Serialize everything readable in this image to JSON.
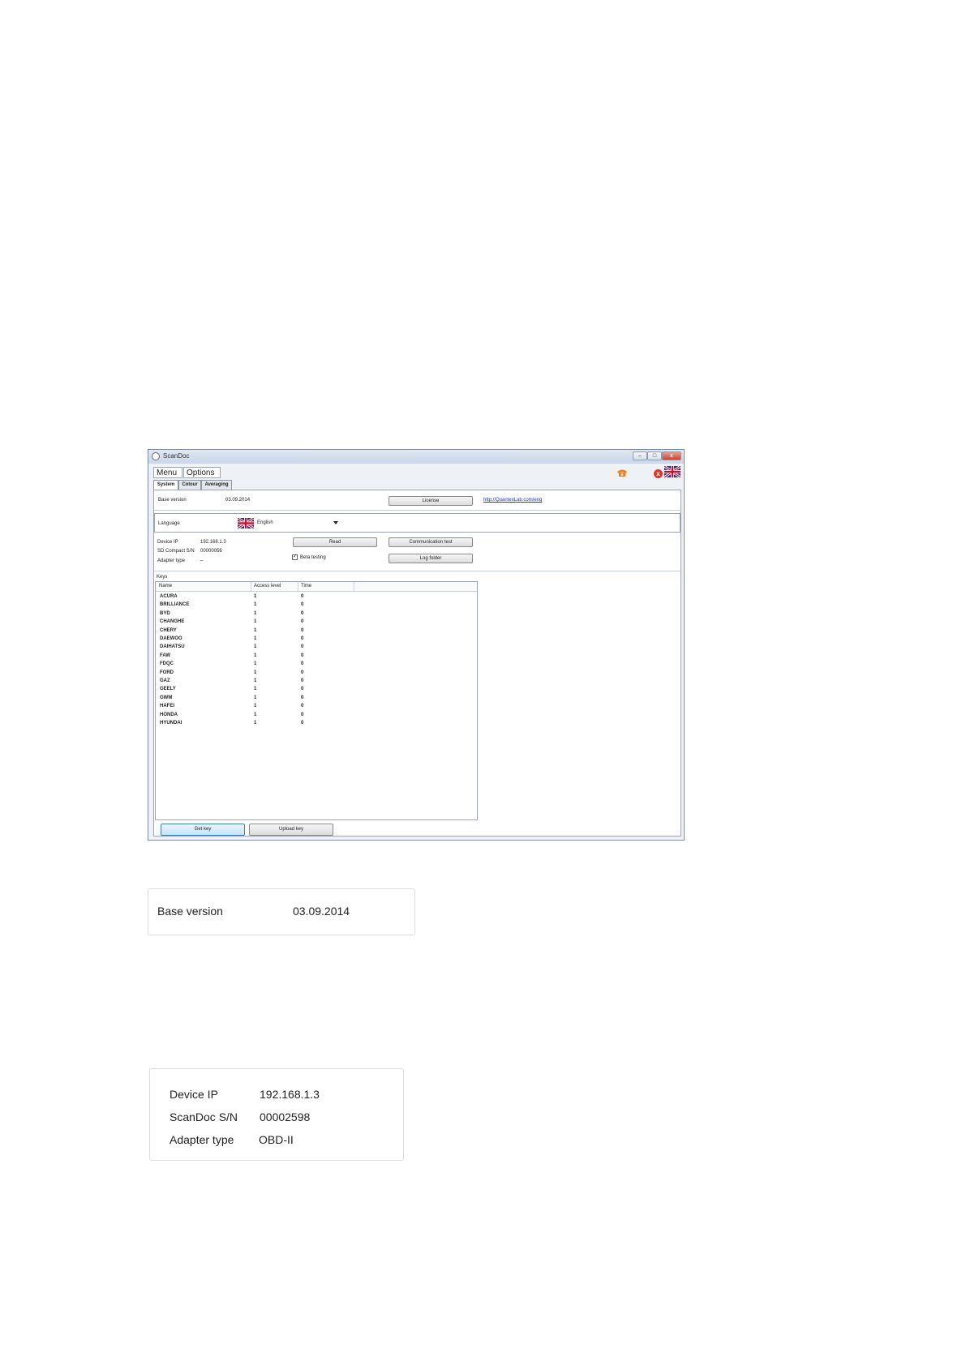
{
  "window": {
    "title": "ScanDoc",
    "controls": {
      "minimize": "–",
      "maximize": "□",
      "close": "x"
    }
  },
  "menu": {
    "items": [
      "Menu",
      "Options"
    ]
  },
  "tabs": [
    "System",
    "Colour",
    "Averaging"
  ],
  "system": {
    "base_version_label": "Base version",
    "base_version_value": "03.09.2014",
    "license_button": "License",
    "link": "http://QuantexLab.com/eng",
    "language_label": "Language",
    "language_value": "English",
    "device_ip_label": "Device IP",
    "device_ip_value": "192.168.1.3",
    "sn_label": "SD Compact S/N",
    "sn_value": "00000056",
    "adapter_label": "Adapter type",
    "adapter_value": "--",
    "read_button": "Read",
    "comm_test_button": "Communication test",
    "beta_label": "Beta testing",
    "beta_checked": true,
    "log_button": "Log folder"
  },
  "keys": {
    "legend": "Keys",
    "columns": [
      "Name",
      "Access level",
      "Time"
    ],
    "rows": [
      {
        "name": "ACURA",
        "level": "1",
        "time": "0"
      },
      {
        "name": "BRILLIANCE",
        "level": "1",
        "time": "0"
      },
      {
        "name": "BYD",
        "level": "1",
        "time": "0"
      },
      {
        "name": "CHANGHE",
        "level": "1",
        "time": "0"
      },
      {
        "name": "CHERY",
        "level": "1",
        "time": "0"
      },
      {
        "name": "DAEWOO",
        "level": "1",
        "time": "0"
      },
      {
        "name": "DAIHATSU",
        "level": "1",
        "time": "0"
      },
      {
        "name": "FAW",
        "level": "1",
        "time": "0"
      },
      {
        "name": "FDQC",
        "level": "1",
        "time": "0"
      },
      {
        "name": "FORD",
        "level": "1",
        "time": "0"
      },
      {
        "name": "GAZ",
        "level": "1",
        "time": "0"
      },
      {
        "name": "GEELY",
        "level": "1",
        "time": "0"
      },
      {
        "name": "GWM",
        "level": "1",
        "time": "0"
      },
      {
        "name": "HAFEI",
        "level": "1",
        "time": "0"
      },
      {
        "name": "HONDA",
        "level": "1",
        "time": "0"
      },
      {
        "name": "HYUNDAI",
        "level": "1",
        "time": "0"
      }
    ],
    "get_key_button": "Get key",
    "upload_key_button": "Upload key"
  },
  "zoom_base": {
    "label": "Base version",
    "value": "03.09.2014"
  },
  "zoom_device": {
    "device_ip_label": "Device IP",
    "device_ip_value": "192.168.1.3",
    "sn_label": "ScanDoc S/N",
    "sn_value": "00002598",
    "adapter_label": "Adapter type",
    "adapter_value": "OBD-II"
  },
  "colors": {
    "accent": "#3c7fb1",
    "link": "#1a35c8",
    "error": "#d9382a",
    "phone": "#f07d1a"
  }
}
